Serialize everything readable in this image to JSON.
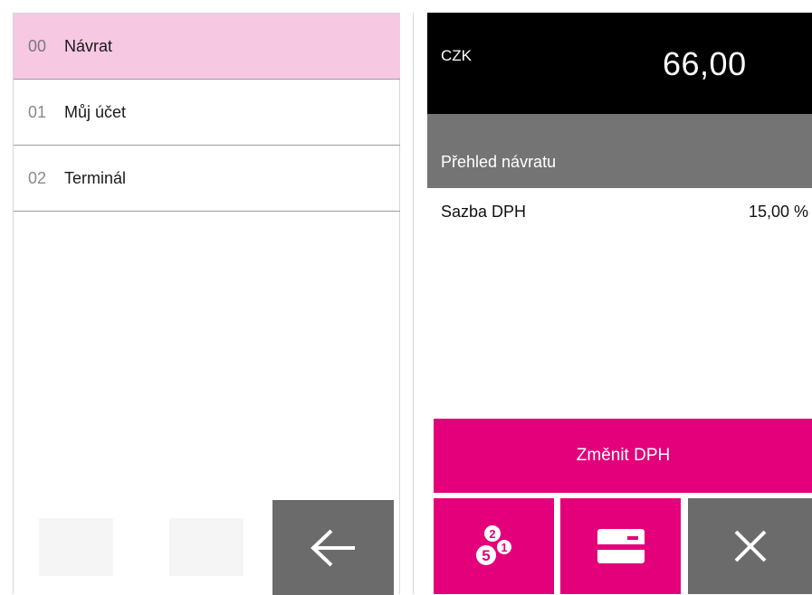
{
  "left_screen": {
    "menu": [
      {
        "number": "00",
        "label": "Návrat",
        "selected": true
      },
      {
        "number": "01",
        "label": "Můj účet",
        "selected": false
      },
      {
        "number": "02",
        "label": "Terminál",
        "selected": false
      }
    ],
    "back_icon": "arrow-left-icon"
  },
  "right_screen": {
    "currency": "CZK",
    "amount": "66,00",
    "section_title": "Přehled návratu",
    "vat": {
      "label": "Sazba DPH",
      "value": "15,00 %"
    },
    "change_vat_label": "Změnit DPH",
    "icons": [
      "coins-icon",
      "card-icon",
      "close-icon"
    ]
  },
  "colors": {
    "accent": "#e3007a",
    "selected_row": "#f7c8e1",
    "dark_gray": "#6b6b6b",
    "section_gray": "#747474",
    "black": "#000000"
  }
}
